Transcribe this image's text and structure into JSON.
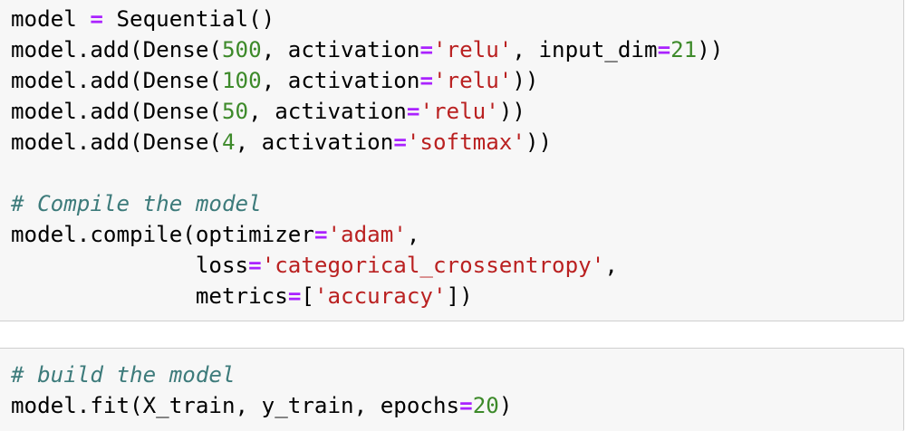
{
  "cells": [
    {
      "lines": [
        [
          [
            "name",
            "model "
          ],
          [
            "op",
            "="
          ],
          [
            "name",
            " Sequential()"
          ]
        ],
        [
          [
            "name",
            "model.add(Dense("
          ],
          [
            "num",
            "500"
          ],
          [
            "name",
            ", activation"
          ],
          [
            "op",
            "="
          ],
          [
            "str",
            "'relu'"
          ],
          [
            "name",
            ", input_dim"
          ],
          [
            "op",
            "="
          ],
          [
            "num",
            "21"
          ],
          [
            "name",
            "))"
          ]
        ],
        [
          [
            "name",
            "model.add(Dense("
          ],
          [
            "num",
            "100"
          ],
          [
            "name",
            ", activation"
          ],
          [
            "op",
            "="
          ],
          [
            "str",
            "'relu'"
          ],
          [
            "name",
            "))"
          ]
        ],
        [
          [
            "name",
            "model.add(Dense("
          ],
          [
            "num",
            "50"
          ],
          [
            "name",
            ", activation"
          ],
          [
            "op",
            "="
          ],
          [
            "str",
            "'relu'"
          ],
          [
            "name",
            "))"
          ]
        ],
        [
          [
            "name",
            "model.add(Dense("
          ],
          [
            "num",
            "4"
          ],
          [
            "name",
            ", activation"
          ],
          [
            "op",
            "="
          ],
          [
            "str",
            "'softmax'"
          ],
          [
            "name",
            "))"
          ]
        ],
        [],
        [
          [
            "com",
            "# Compile the model"
          ]
        ],
        [
          [
            "name",
            "model.compile(optimizer"
          ],
          [
            "op",
            "="
          ],
          [
            "str",
            "'adam'"
          ],
          [
            "name",
            ","
          ]
        ],
        [
          [
            "name",
            "              loss"
          ],
          [
            "op",
            "="
          ],
          [
            "str",
            "'categorical_crossentropy'"
          ],
          [
            "name",
            ","
          ]
        ],
        [
          [
            "name",
            "              metrics"
          ],
          [
            "op",
            "="
          ],
          [
            "name",
            "["
          ],
          [
            "str",
            "'accuracy'"
          ],
          [
            "name",
            "])"
          ]
        ]
      ]
    },
    {
      "lines": [
        [
          [
            "com",
            "# build the model"
          ]
        ],
        [
          [
            "name",
            "model.fit(X_train, y_train, epochs"
          ],
          [
            "op",
            "="
          ],
          [
            "num",
            "20"
          ],
          [
            "name",
            ")"
          ]
        ]
      ]
    }
  ],
  "colors": {
    "cell_background": "#f7f7f7",
    "cell_border": "#cfcfcf",
    "keyword_operator": "#aa22ff",
    "number": "#3d8a2a",
    "string": "#ba2121",
    "comment": "#3d7b7b"
  }
}
